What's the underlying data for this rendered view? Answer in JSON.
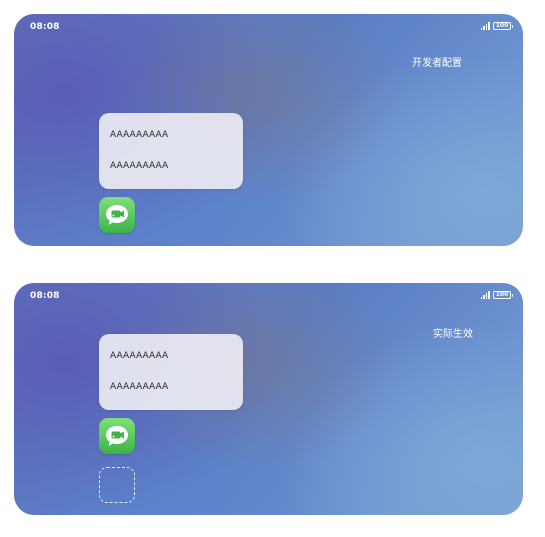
{
  "screens": [
    {
      "status_time": "08:08",
      "battery": "100",
      "corner_label": "开发者配置",
      "widget_lines": [
        "AAAAAAAAA",
        "AAAAAAAAA"
      ],
      "app_icon": "messaging-app-icon"
    },
    {
      "status_time": "08:08",
      "battery": "100",
      "corner_label": "实际生效",
      "widget_lines": [
        "AAAAAAAAA",
        "AAAAAAAAA"
      ],
      "app_icon": "messaging-app-icon",
      "placeholder_slot": "empty-drop-slot"
    }
  ],
  "colors": {
    "app_icon_green": "#4cc35a",
    "widget_card": "#ececf2",
    "wallpaper_blue": "#5a7dc4"
  }
}
